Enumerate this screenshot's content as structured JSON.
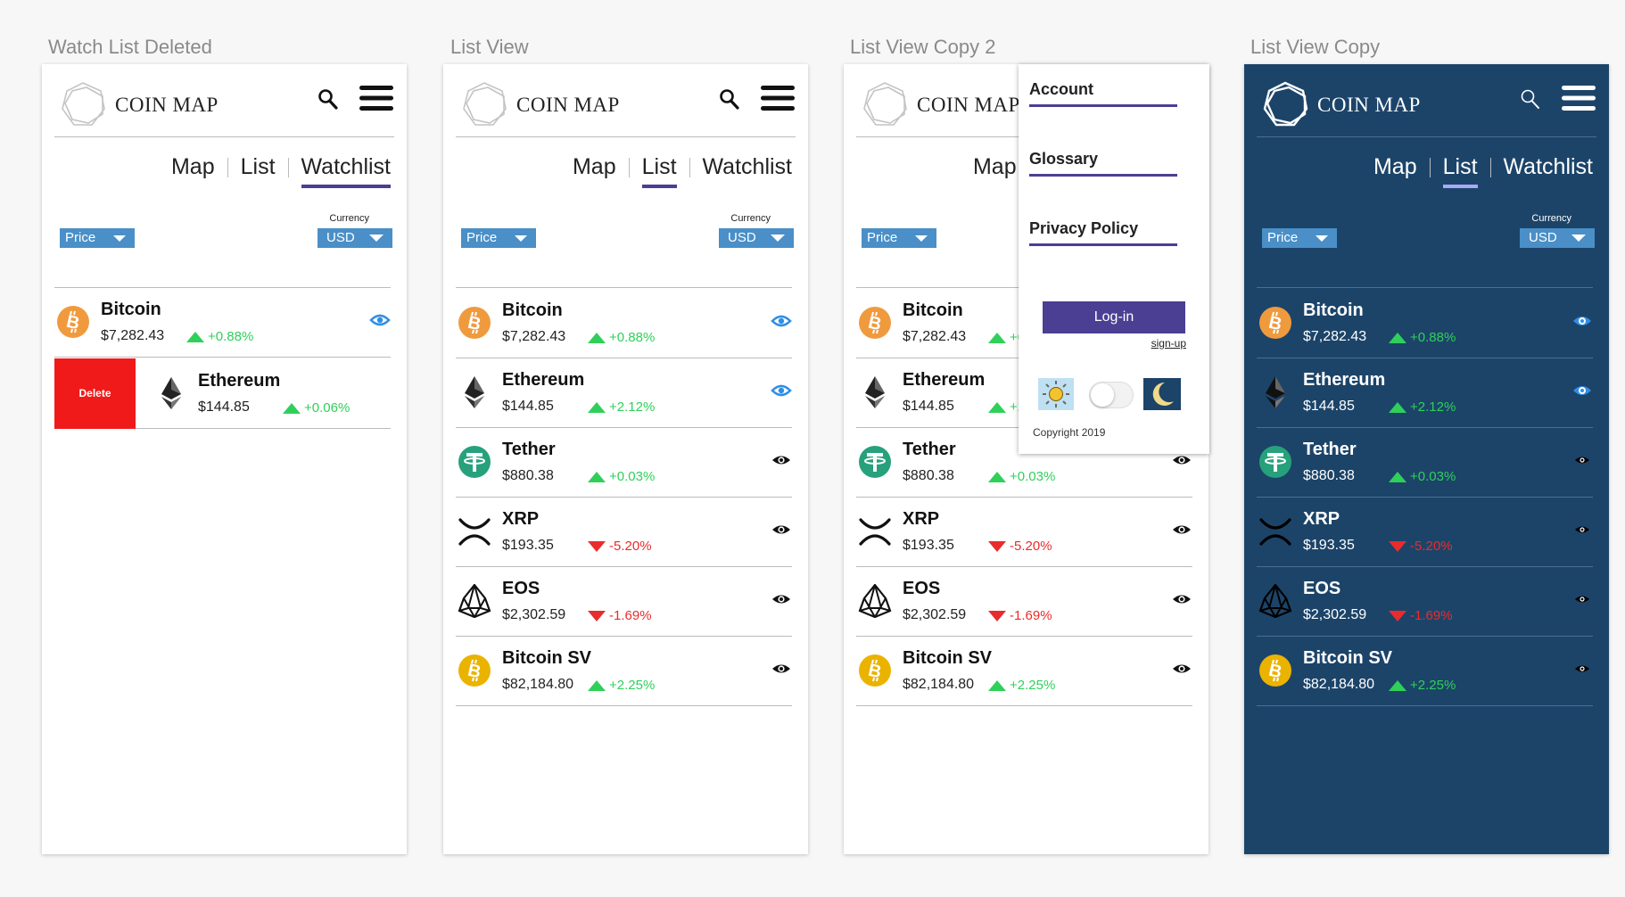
{
  "artboards": [
    {
      "label": "Watch List Deleted",
      "active_tab": "Watchlist",
      "theme": "light"
    },
    {
      "label": "List View",
      "active_tab": "List",
      "theme": "light"
    },
    {
      "label": "List View Copy 2",
      "active_tab": "List",
      "theme": "light"
    },
    {
      "label": "List View Copy",
      "active_tab": "List",
      "theme": "dark"
    }
  ],
  "app": {
    "brand": "COIN MAP",
    "tabs": [
      "Map",
      "List",
      "Watchlist"
    ],
    "price_select": "Price",
    "currency_label": "Currency",
    "currency_select": "USD",
    "delete_label": "Delete"
  },
  "coins": [
    {
      "name": "Bitcoin",
      "price": "$7,282.43",
      "change": "+0.88%",
      "direction": "up",
      "watched": true,
      "icon": "bitcoin-icon"
    },
    {
      "name": "Ethereum",
      "price": "$144.85",
      "change": "+2.12%",
      "direction": "up",
      "watched": true,
      "icon": "ethereum-icon"
    },
    {
      "name": "Tether",
      "price": "$880.38",
      "change": "+0.03%",
      "direction": "up",
      "watched": false,
      "icon": "tether-icon"
    },
    {
      "name": "XRP",
      "price": "$193.35",
      "change": "-5.20%",
      "direction": "down",
      "watched": false,
      "icon": "xrp-icon"
    },
    {
      "name": "EOS",
      "price": "$2,302.59",
      "change": "-1.69%",
      "direction": "down",
      "watched": false,
      "icon": "eos-icon"
    },
    {
      "name": "Bitcoin SV",
      "price": "$82,184.80",
      "change": "+2.25%",
      "direction": "up",
      "watched": false,
      "icon": "bitcoin-sv-icon"
    }
  ],
  "watchlist": [
    {
      "name": "Bitcoin",
      "price": "$7,282.43",
      "change": "+0.88%",
      "direction": "up"
    },
    {
      "name": "Ethereum",
      "price": "$144.85",
      "change": "+0.06%",
      "direction": "up"
    }
  ],
  "menu": {
    "items": [
      "Account",
      "Glossary",
      "Privacy Policy"
    ],
    "login_label": "Log-in",
    "signup_label": "sign-up",
    "copyright": "Copyright 2019"
  },
  "colors": {
    "accent": "#4a3f93",
    "select_blue": "#4a8fc7",
    "positive": "#2fd05a",
    "negative": "#ea2b2b",
    "delete": "#f01a1a",
    "dark_bg": "#1c4469",
    "bitcoin": "#f09a3e",
    "bitcoin_sv": "#eab300",
    "tether": "#26a17b",
    "eye_watched": "#2f8fe6"
  }
}
